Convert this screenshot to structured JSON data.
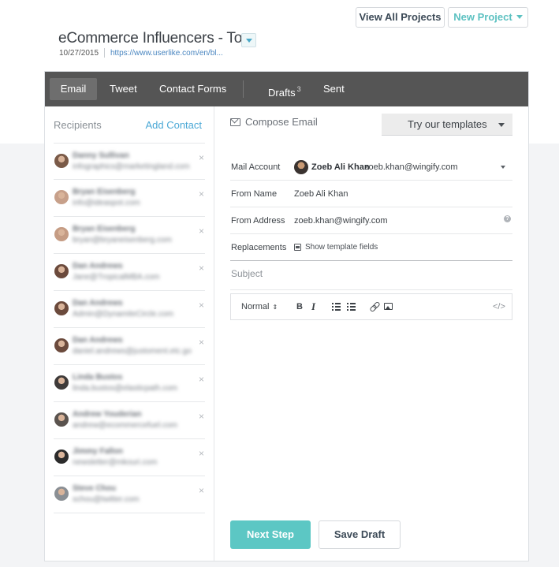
{
  "header": {
    "view_all_label": "View All Projects",
    "new_project_label": "New Project",
    "project_title": "eCommerce Influencers - Top",
    "project_date": "10/27/2015",
    "project_url": "https://www.userlike.com/en/bl..."
  },
  "nav": {
    "tabs": [
      "Email",
      "Tweet",
      "Contact Forms"
    ],
    "drafts_label": "Drafts",
    "drafts_count": "3",
    "sent_label": "Sent",
    "active_tab": "Email"
  },
  "recipients": {
    "title": "Recipients",
    "add_contact_label": "Add Contact",
    "remove_icon": "×",
    "items": [
      {
        "name": "Danny Sullivan",
        "email": "infographics@marketingland.com",
        "avatar_color": "#7a5a48"
      },
      {
        "name": "Bryan Eisenberg",
        "email": "info@ideaspot.com",
        "avatar_color": "#c7a08a"
      },
      {
        "name": "Bryan Eisenberg",
        "email": "bryan@bryaneisenberg.com",
        "avatar_color": "#c59c84"
      },
      {
        "name": "Dan Andrews",
        "email": "Jane@TropicalMBA.com",
        "avatar_color": "#6b4a3c"
      },
      {
        "name": "Dan Andrews",
        "email": "Admin@DynamiteCircle.com",
        "avatar_color": "#6b4a3c"
      },
      {
        "name": "Dan Andrews",
        "email": "daniel.andrews@justoment.etc.go",
        "avatar_color": "#6b4a3c"
      },
      {
        "name": "Linda Bustos",
        "email": "linda.bustos@elasticpath.com",
        "avatar_color": "#3e3a39"
      },
      {
        "name": "Andrew Youderian",
        "email": "andrew@ecommercefuel.com",
        "avatar_color": "#5a534e"
      },
      {
        "name": "Jimmy Fallon",
        "email": "newsletter@mkouri.com",
        "avatar_color": "#2b2b2b"
      },
      {
        "name": "Steve Chou",
        "email": "schou@twitter.com",
        "avatar_color": "#8a8f94"
      }
    ]
  },
  "compose": {
    "title": "Compose Email",
    "templates_label": "Try our templates",
    "fields": {
      "mail_account_label": "Mail Account",
      "mail_account_name": "Zoeb Ali Khan",
      "mail_account_email": "zoeb.khan@wingify.com",
      "from_name_label": "From Name",
      "from_name_value": "Zoeb Ali Khan",
      "from_address_label": "From Address",
      "from_address_value": "zoeb.khan@wingify.com",
      "replacements_label": "Replacements",
      "show_template_fields": "Show template fields"
    },
    "subject_placeholder": "Subject",
    "toolbar": {
      "format_label": "Normal",
      "bold_label": "B",
      "italic_label": "I",
      "code_label": "</>"
    },
    "next_step_label": "Next Step",
    "save_draft_label": "Save Draft"
  }
}
